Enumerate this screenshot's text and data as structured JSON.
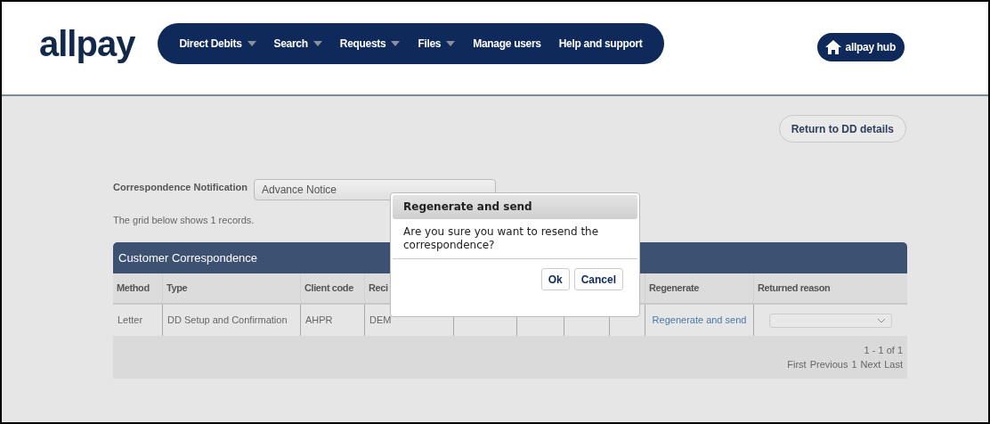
{
  "header": {
    "logo": "allpay",
    "nav": [
      {
        "label": "Direct Debits",
        "dropdown": true
      },
      {
        "label": "Search",
        "dropdown": true
      },
      {
        "label": "Requests",
        "dropdown": true
      },
      {
        "label": "Files",
        "dropdown": true
      },
      {
        "label": "Manage users",
        "dropdown": false
      },
      {
        "label": "Help and support",
        "dropdown": false
      }
    ],
    "hub_button": "allpay hub"
  },
  "return_button": "Return to DD details",
  "notification": {
    "label": "Correspondence Notification",
    "value": "Advance Notice"
  },
  "grid_note": "The grid below shows 1 records.",
  "table": {
    "title": "Customer Correspondence",
    "columns": [
      {
        "label": "Method"
      },
      {
        "label": "Type"
      },
      {
        "label": "Client code"
      },
      {
        "label": "Reci"
      },
      {},
      {},
      {},
      {},
      {
        "label": "Regenerate"
      },
      {
        "label": "Returned reason"
      }
    ],
    "rows": [
      [
        {
          "kind": "text",
          "text": "Letter"
        },
        {
          "kind": "text",
          "text": "DD Setup and Confirmation"
        },
        {
          "kind": "text",
          "text": "AHPR"
        },
        {
          "kind": "text",
          "text": "DEM"
        },
        {
          "kind": "text"
        },
        {
          "kind": "text"
        },
        {
          "kind": "text"
        },
        {
          "kind": "text"
        },
        {
          "kind": "link",
          "text": "Regenerate and send"
        },
        {
          "kind": "select"
        }
      ]
    ],
    "pager": {
      "summary": "1 - 1 of 1",
      "links": [
        "First",
        "Previous",
        "1",
        "Next",
        "Last"
      ]
    }
  },
  "dialog": {
    "title": "Regenerate and send",
    "message": "Are you sure you want to resend the correspondence?",
    "buttons": [
      "Ok",
      "Cancel"
    ]
  }
}
